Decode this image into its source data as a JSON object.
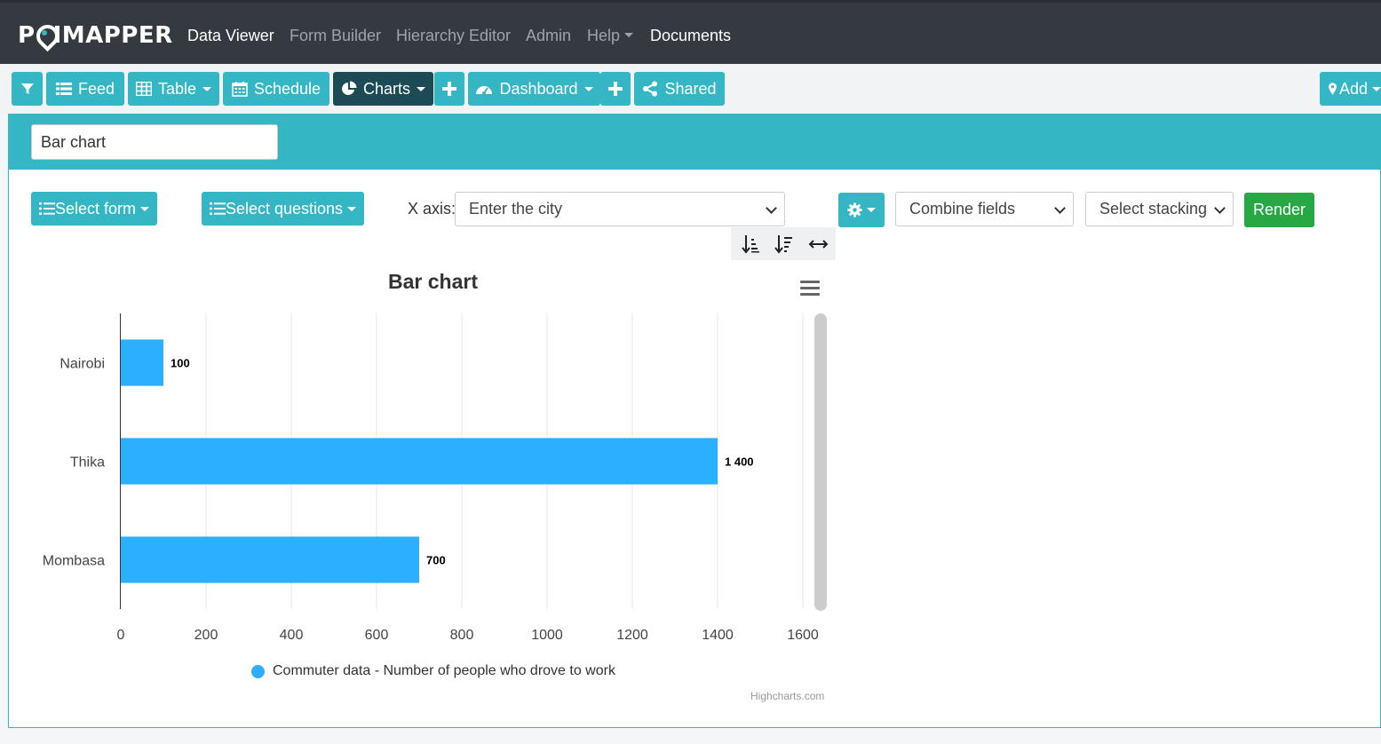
{
  "app": {
    "brand": "POIMAPPER",
    "nav": [
      {
        "label": "Data Viewer",
        "active": true
      },
      {
        "label": "Form Builder",
        "active": false
      },
      {
        "label": "Hierarchy Editor",
        "active": false
      },
      {
        "label": "Admin",
        "active": false
      },
      {
        "label": "Help",
        "active": false,
        "dropdown": true
      },
      {
        "label": "Documents",
        "active": true
      }
    ]
  },
  "toolbar": {
    "filter_icon": "filter-icon",
    "feed": "Feed",
    "table": "Table",
    "schedule": "Schedule",
    "charts": "Charts",
    "dashboard": "Dashboard",
    "shared": "Shared",
    "add": "Add"
  },
  "panel": {
    "chart_name_value": "Bar chart",
    "select_form": "Select form",
    "select_questions": "Select questions",
    "xaxis_label": "X axis:",
    "xaxis_value": "Enter the city",
    "combine_fields": "Combine fields",
    "select_stacking": "Select stacking",
    "render": "Render"
  },
  "colors": {
    "teal": "#35b6c4",
    "dark_teal": "#1d4b55",
    "navbar": "#353a41",
    "render_green": "#28a745",
    "bar": "#2caffe"
  },
  "chart_data": {
    "type": "bar",
    "orientation": "horizontal",
    "title": "Bar chart",
    "categories": [
      "Nairobi",
      "Thika",
      "Mombasa"
    ],
    "series": [
      {
        "name": "Commuter data - Number of people who drove to work",
        "values": [
          100,
          1400,
          700
        ]
      }
    ],
    "data_labels": [
      "100",
      "1 400",
      "700"
    ],
    "xlim": [
      0,
      1600
    ],
    "ticks": [
      "0",
      "200",
      "400",
      "600",
      "800",
      "1000",
      "1200",
      "1400",
      "1600"
    ],
    "grid": true,
    "legend": "bottom",
    "credits": "Highcharts.com"
  }
}
